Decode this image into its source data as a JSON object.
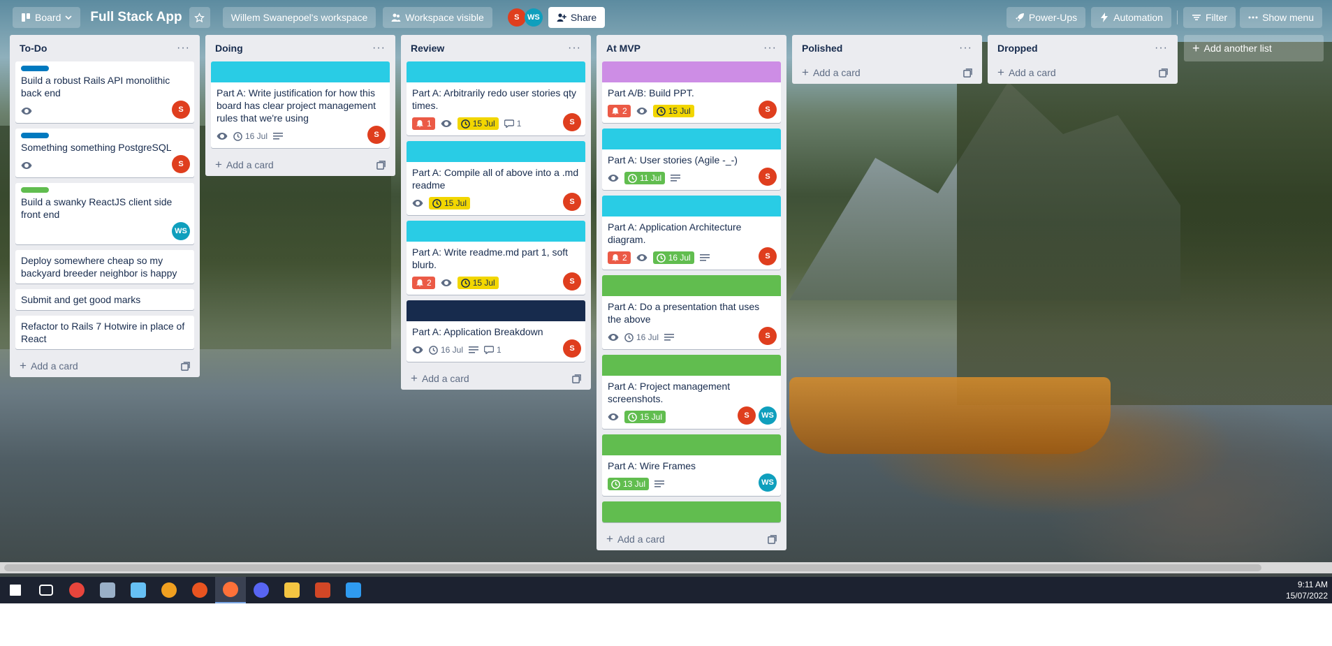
{
  "header": {
    "board_switcher_label": "Board",
    "board_title": "Full Stack App",
    "workspace_label": "Willem Swanepoel's workspace",
    "visibility_label": "Workspace visible",
    "members": [
      "S",
      "WS"
    ],
    "share_label": "Share",
    "power_ups_label": "Power-Ups",
    "automation_label": "Automation",
    "filter_label": "Filter",
    "show_menu_label": "Show menu"
  },
  "colors": {
    "cover_cyan": "#29cce5",
    "cover_purple": "#cd8de5",
    "cover_navy": "#172b4d",
    "cover_green": "#61bd4f",
    "label_blue": "#0079bf",
    "label_green": "#61bd4f"
  },
  "lists": [
    {
      "title": "To-Do",
      "add_card_label": "Add a card",
      "cards": [
        {
          "title": "Build a robust Rails API monolithic back end",
          "label": "#0079bf",
          "watch": true,
          "members": [
            "S"
          ]
        },
        {
          "title": "Something something PostgreSQL",
          "label": "#0079bf",
          "watch": true,
          "members": [
            "S"
          ]
        },
        {
          "title": "Build a swanky ReactJS client side front end",
          "label": "#61bd4f",
          "members": [
            "WS"
          ]
        },
        {
          "title": "Deploy somewhere cheap so my backyard breeder neighbor is happy"
        },
        {
          "title": "Submit and get good marks"
        },
        {
          "title": "Refactor to Rails 7 Hotwire in place of React"
        }
      ]
    },
    {
      "title": "Doing",
      "add_card_label": "Add a card",
      "cards": [
        {
          "title": "Part A: Write justification for how this board has clear project management rules that we're using",
          "cover": "#29cce5",
          "watch": true,
          "due": "16 Jul",
          "due_style": "plain",
          "description": true,
          "members": [
            "S"
          ]
        }
      ]
    },
    {
      "title": "Review",
      "add_card_label": "Add a card",
      "cards": [
        {
          "title": "Part A: Arbitrarily redo user stories qty times.",
          "cover": "#29cce5",
          "notifications": "1",
          "watch": true,
          "due": "15 Jul",
          "due_style": "yellow",
          "comments": "1",
          "members": [
            "S"
          ]
        },
        {
          "title": "Part A: Compile all of above into a .md readme",
          "cover": "#29cce5",
          "watch": true,
          "due": "15 Jul",
          "due_style": "yellow",
          "members": [
            "S"
          ]
        },
        {
          "title": "Part A: Write readme.md part 1, soft blurb.",
          "cover": "#29cce5",
          "notifications": "2",
          "watch": true,
          "due": "15 Jul",
          "due_style": "yellow",
          "members": [
            "S"
          ]
        },
        {
          "title": "Part A: Application Breakdown",
          "cover": "#172b4d",
          "watch": true,
          "due": "16 Jul",
          "due_style": "plain",
          "description": true,
          "comments": "1",
          "members": [
            "S"
          ]
        }
      ]
    },
    {
      "title": "At MVP",
      "add_card_label": "Add a card",
      "cards": [
        {
          "title": "Part A/B: Build PPT.",
          "cover": "#cd8de5",
          "notifications": "2",
          "watch": true,
          "due": "15 Jul",
          "due_style": "yellow",
          "members": [
            "S"
          ]
        },
        {
          "title": "Part A: User stories (Agile -_-)",
          "cover": "#29cce5",
          "watch": true,
          "due": "11 Jul",
          "due_style": "green",
          "description": true,
          "members": [
            "S"
          ]
        },
        {
          "title": "Part A: Application Architecture diagram.",
          "cover": "#29cce5",
          "notifications": "2",
          "watch": true,
          "due": "16 Jul",
          "due_style": "green",
          "description": true,
          "members": [
            "S"
          ]
        },
        {
          "title": "Part A: Do a presentation that uses the above",
          "cover": "#61bd4f",
          "watch": true,
          "due": "16 Jul",
          "due_style": "plain",
          "description": true,
          "members": [
            "S"
          ]
        },
        {
          "title": "Part A: Project management screenshots.",
          "cover": "#61bd4f",
          "watch": true,
          "due": "15 Jul",
          "due_style": "green",
          "members": [
            "S",
            "WS"
          ]
        },
        {
          "title": "Part A: Wire Frames",
          "cover": "#61bd4f",
          "due": "13 Jul",
          "due_style": "green",
          "description": true,
          "members": [
            "WS"
          ]
        },
        {
          "title": "",
          "cover": "#61bd4f",
          "partial": true
        }
      ]
    },
    {
      "title": "Polished",
      "add_card_label": "Add a card",
      "cards": []
    },
    {
      "title": "Dropped",
      "add_card_label": "Add a card",
      "cards": []
    }
  ],
  "add_list_label": "Add another list",
  "taskbar": {
    "apps": [
      "windows-start",
      "task-view",
      "chrome",
      "app-tux",
      "steam",
      "app-game",
      "ubuntu",
      "firefox",
      "discord",
      "file-explorer",
      "powerpoint",
      "vscode"
    ],
    "active_app": "firefox",
    "time": "9:11 AM",
    "date": "15/07/2022"
  }
}
